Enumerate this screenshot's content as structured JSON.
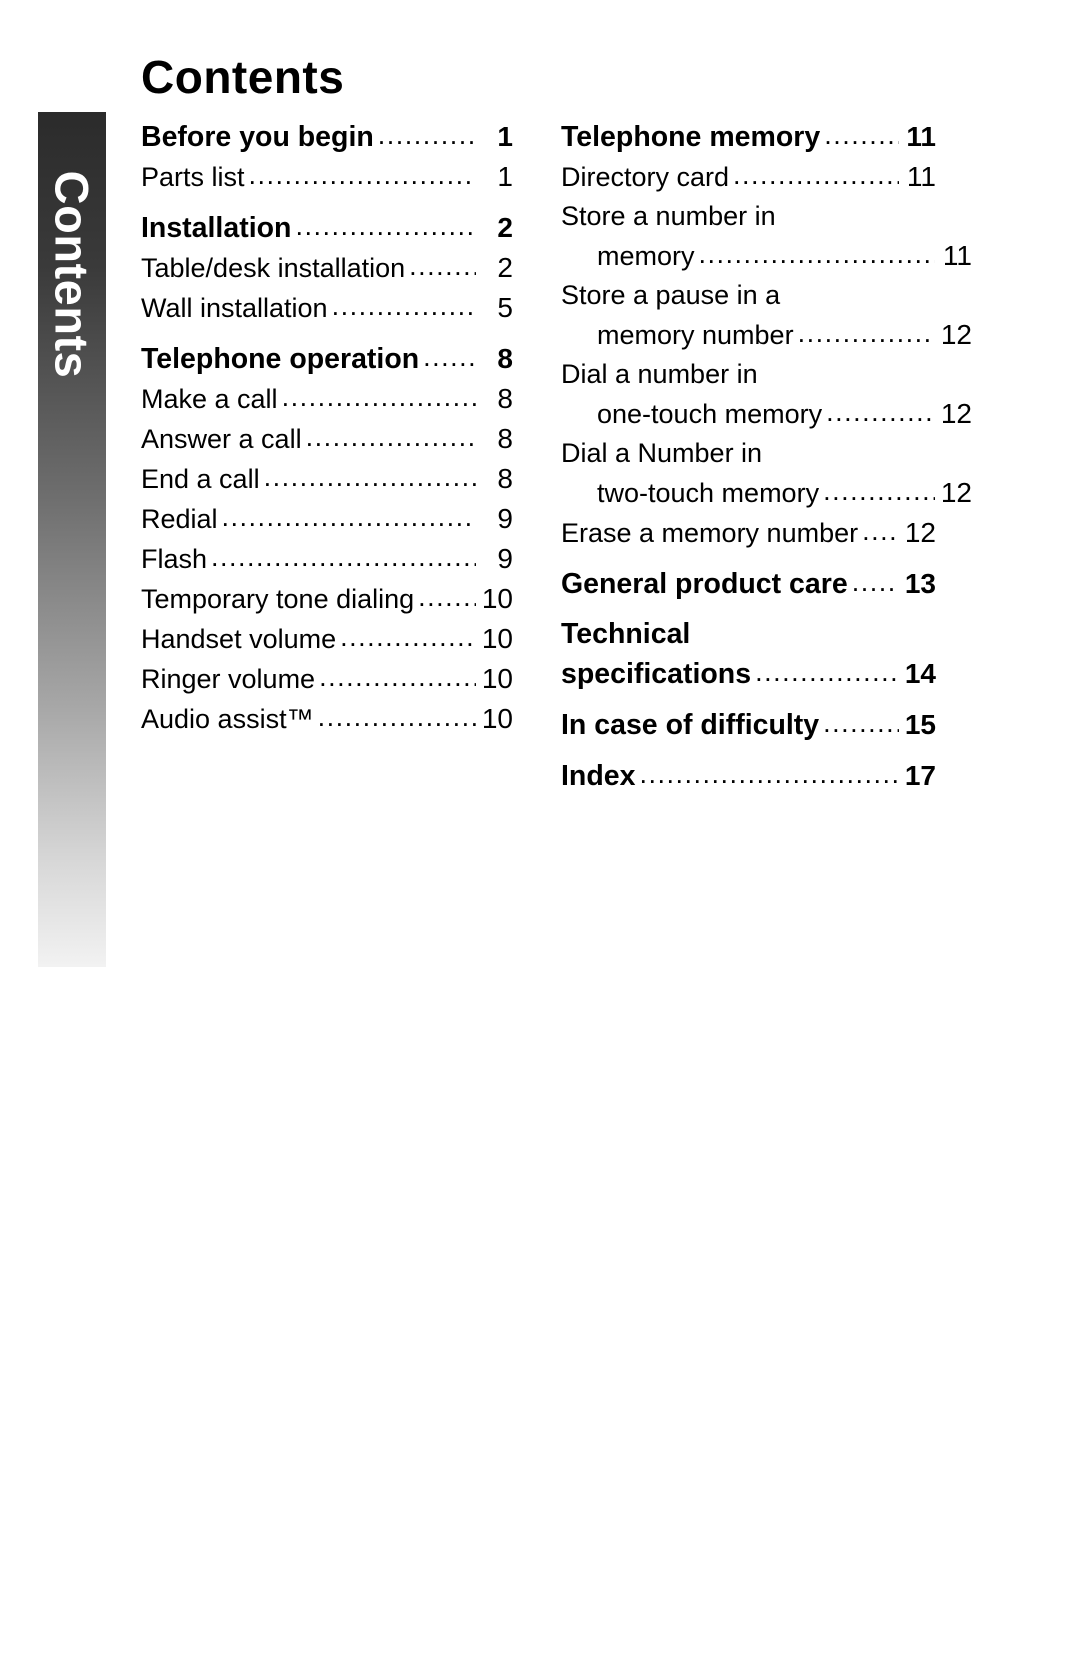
{
  "page": {
    "title": "Contents",
    "side_tab_label": "Contents"
  },
  "dot_leader": "..................................................................................",
  "columns": {
    "left": [
      {
        "text": "Before you begin",
        "page": "1",
        "bold": true,
        "indent": false
      },
      {
        "text": "Parts list",
        "page": "1",
        "bold": false,
        "indent": false
      },
      {
        "text": "Installation",
        "page": "2",
        "bold": true,
        "indent": false,
        "gap": true
      },
      {
        "text": "Table/desk installation",
        "page": "2",
        "bold": false,
        "indent": false
      },
      {
        "text": "Wall installation",
        "page": "5",
        "bold": false,
        "indent": false
      },
      {
        "text": "Telephone operation",
        "page": "8",
        "bold": true,
        "indent": false,
        "gap": true
      },
      {
        "text": "Make a call",
        "page": "8",
        "bold": false,
        "indent": false
      },
      {
        "text": "Answer a call",
        "page": "8",
        "bold": false,
        "indent": false
      },
      {
        "text": "End a call",
        "page": "8",
        "bold": false,
        "indent": false
      },
      {
        "text": "Redial",
        "page": "9",
        "bold": false,
        "indent": false
      },
      {
        "text": "Flash",
        "page": "9",
        "bold": false,
        "indent": false
      },
      {
        "text": "Temporary tone dialing",
        "page": "10",
        "bold": false,
        "indent": false
      },
      {
        "text": "Handset volume",
        "page": "10",
        "bold": false,
        "indent": false
      },
      {
        "text": "Ringer volume",
        "page": "10",
        "bold": false,
        "indent": false
      },
      {
        "text": "Audio assist™",
        "page": "10",
        "bold": false,
        "indent": false
      }
    ],
    "right": [
      {
        "text": "Telephone memory",
        "page": "11",
        "bold": true,
        "indent": false
      },
      {
        "text": "Directory card",
        "page": "11",
        "bold": false,
        "indent": false
      },
      {
        "text": "Store a number in",
        "page": "",
        "bold": false,
        "indent": false,
        "nodots": true
      },
      {
        "text": "memory",
        "page": "11",
        "bold": false,
        "indent": true
      },
      {
        "text": "Store a pause in a",
        "page": "",
        "bold": false,
        "indent": false,
        "nodots": true
      },
      {
        "text": "memory number",
        "page": "12",
        "bold": false,
        "indent": true
      },
      {
        "text": "Dial a number in",
        "page": "",
        "bold": false,
        "indent": false,
        "nodots": true
      },
      {
        "text": "one-touch memory",
        "page": "12",
        "bold": false,
        "indent": true
      },
      {
        "text": "Dial a Number in",
        "page": "",
        "bold": false,
        "indent": false,
        "nodots": true
      },
      {
        "text": "two-touch memory",
        "page": "12",
        "bold": false,
        "indent": true
      },
      {
        "text": "Erase a memory number",
        "page": "12",
        "bold": false,
        "indent": false
      },
      {
        "text": "General product care",
        "page": "13",
        "bold": true,
        "indent": false,
        "gap": true
      },
      {
        "text": "Technical",
        "page": "",
        "bold": true,
        "indent": false,
        "nodots": true,
        "gap": true
      },
      {
        "text": "specifications",
        "page": "14",
        "bold": true,
        "indent": false
      },
      {
        "text": "In case of difficulty",
        "page": "15",
        "bold": true,
        "indent": false,
        "gap": true
      },
      {
        "text": "Index",
        "page": "17",
        "bold": true,
        "indent": false,
        "gap": true
      }
    ]
  }
}
